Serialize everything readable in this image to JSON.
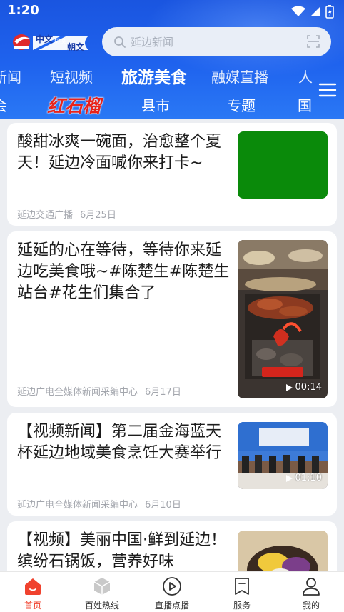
{
  "status_bar": {
    "time": "1:20"
  },
  "header": {
    "logo_text_cn": "中文",
    "logo_switch": "切换",
    "logo_text_kr": "朝文",
    "search_placeholder": "延边新闻"
  },
  "tabs_row1": [
    {
      "label": "新闻"
    },
    {
      "label": "短视频"
    },
    {
      "label": "旅游美食",
      "active": true
    },
    {
      "label": "融媒直播"
    },
    {
      "label": "人"
    }
  ],
  "tabs_row2": [
    {
      "label": "会"
    },
    {
      "label": "红石榴"
    },
    {
      "label": "县市"
    },
    {
      "label": "专题"
    },
    {
      "label": "国"
    }
  ],
  "articles": [
    {
      "title": "酸甜冰爽一碗面，治愈整个夏天！延边冷面喊你来打卡~",
      "source": "延边交通广播",
      "date": "6月25日",
      "thumb_color": "#0a8a0a"
    },
    {
      "title": "延延的心在等待，等待你来延边吃美食哦~#陈楚生#陈楚生站台#花生们集合了",
      "source": "延边广电全媒体新闻采编中心",
      "date": "6月17日",
      "duration": "00:14"
    },
    {
      "title": "【视频新闻】第二届金海蓝天杯延边地域美食烹饪大赛举行",
      "source": "延边广电全媒体新闻采编中心",
      "date": "6月10日",
      "duration": "01:10"
    },
    {
      "title": "【视频】美丽中国·鲜到延边！缤纷石锅饭，营养好味"
    }
  ],
  "bottom_nav": [
    {
      "label": "首页",
      "icon": "home-icon",
      "active": true
    },
    {
      "label": "百姓热线",
      "icon": "cube-icon"
    },
    {
      "label": "直播点播",
      "icon": "play-icon"
    },
    {
      "label": "服务",
      "icon": "bookmark-icon"
    },
    {
      "label": "我的",
      "icon": "person-icon"
    }
  ],
  "colors": {
    "header_blue": "#1f63ee",
    "accent_red": "#f0422e",
    "tab_red": "#e8231c"
  }
}
